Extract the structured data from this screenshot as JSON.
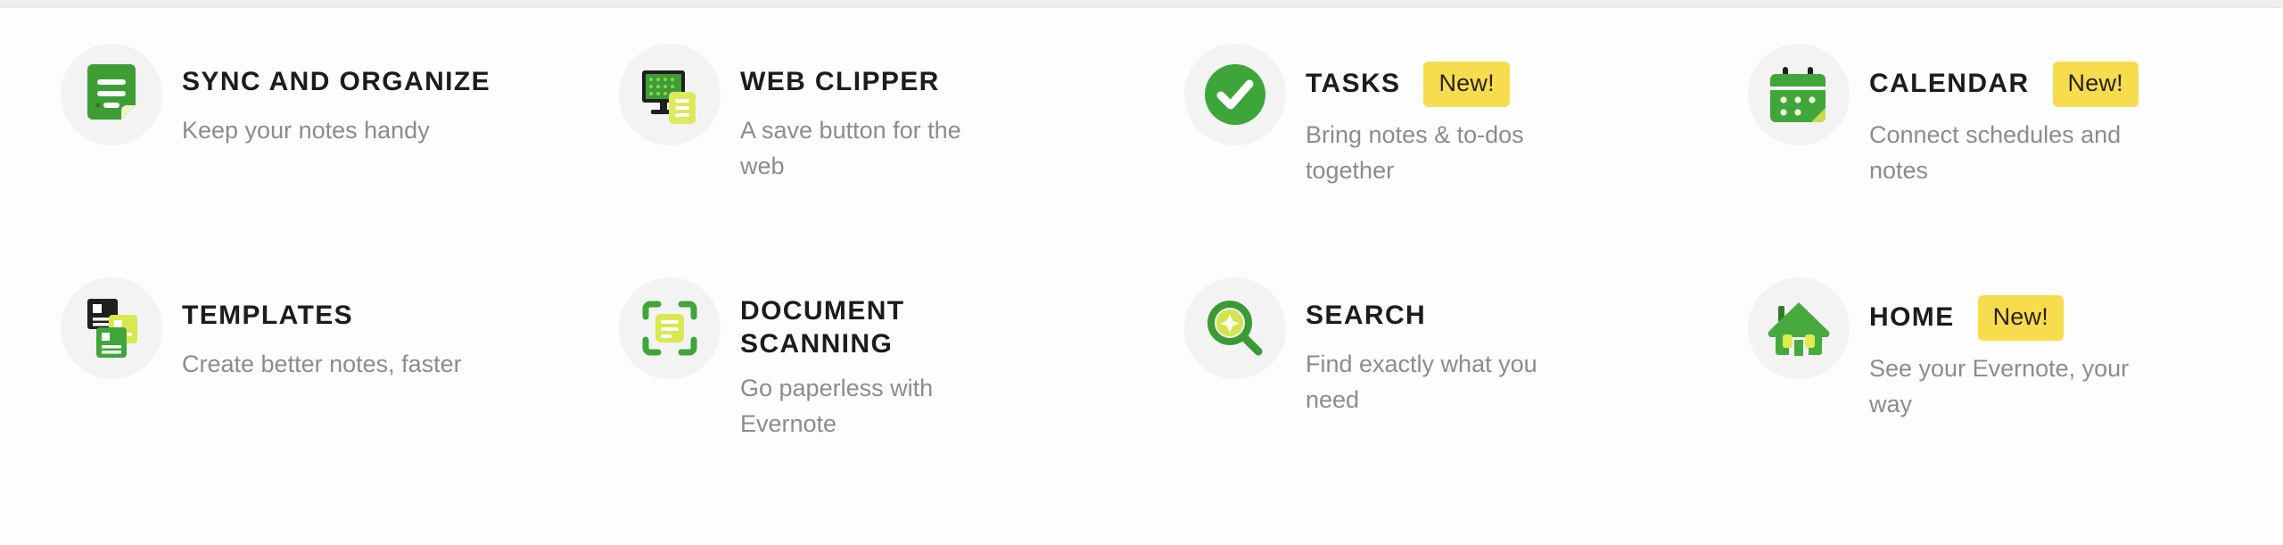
{
  "page": {
    "background_color": "#fdfdfd",
    "top_strip_color": "#efeff0"
  },
  "theme": {
    "title_color": "#1c1c1c",
    "description_color": "#8c8c8c",
    "icon_circle_color": "#f3f3f3",
    "badge_background": "#f7dc4d",
    "badge_text_color": "#26231b",
    "green_dark": "#3a9a35",
    "green_primary": "#2fae46",
    "green_bright": "#43b02a",
    "yellow_green": "#d9e84f",
    "pale_yellow": "#f0f3b8",
    "dark_slate": "#1f1f1f"
  },
  "features": [
    {
      "id": "sync-and-organize",
      "icon": "note-document-icon",
      "title": "SYNC AND ORGANIZE",
      "description": "Keep your notes handy",
      "badge": ""
    },
    {
      "id": "web-clipper",
      "icon": "monitor-clip-icon",
      "title": "WEB CLIPPER",
      "description": "A save button for the web",
      "badge": ""
    },
    {
      "id": "tasks",
      "icon": "check-circle-icon",
      "title": "TASKS",
      "description": "Bring notes & to-dos together",
      "badge": "New!"
    },
    {
      "id": "calendar",
      "icon": "calendar-icon",
      "title": "CALENDAR",
      "description": "Connect schedules and notes",
      "badge": "New!"
    },
    {
      "id": "templates",
      "icon": "stacked-cards-icon",
      "title": "TEMPLATES",
      "description": "Create better notes, faster",
      "badge": ""
    },
    {
      "id": "document-scanning",
      "icon": "scan-frame-icon",
      "title": "DOCUMENT SCANNING",
      "description": "Go paperless with Evernote",
      "badge": ""
    },
    {
      "id": "search",
      "icon": "magnifier-sparkle-icon",
      "title": "SEARCH",
      "description": "Find exactly what you need",
      "badge": ""
    },
    {
      "id": "home",
      "icon": "house-icon",
      "title": "HOME",
      "description": "See your Evernote, your way",
      "badge": "New!"
    }
  ]
}
